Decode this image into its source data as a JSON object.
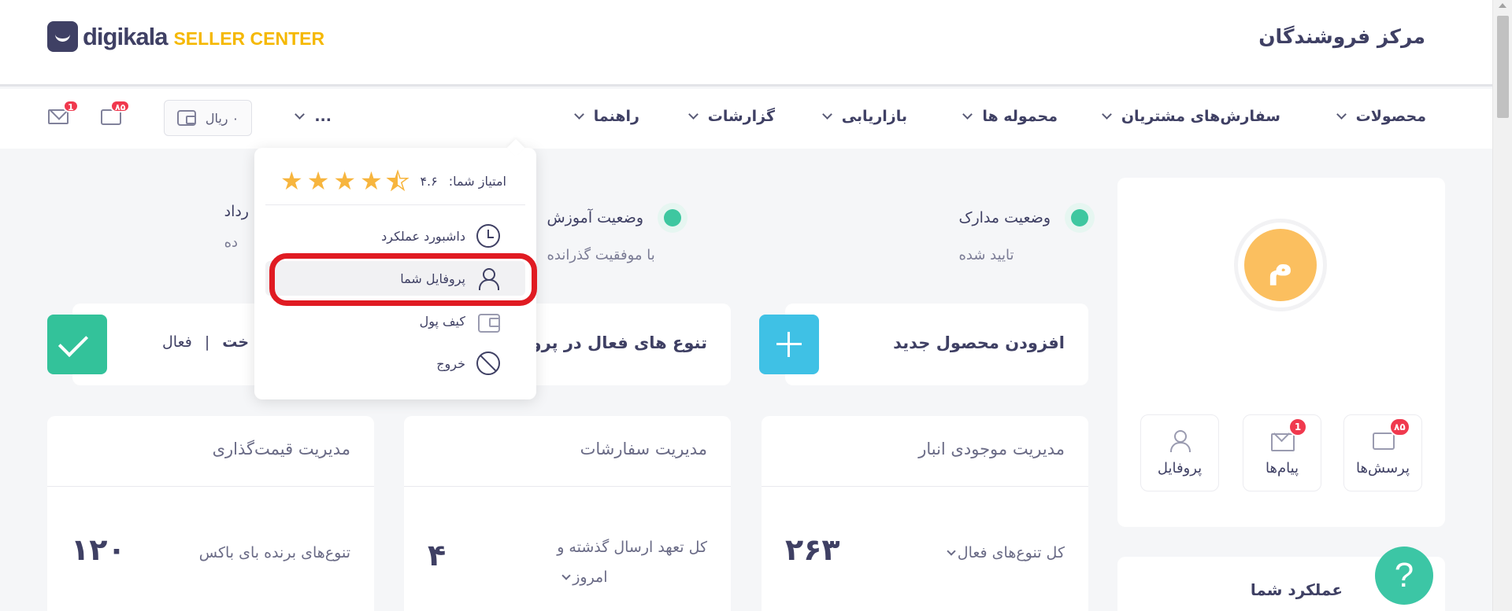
{
  "header": {
    "logo_word": "digikala",
    "logo_sub": "SELLER CENTER",
    "site_title": "مرکز فروشندگان"
  },
  "nav": {
    "items": [
      {
        "label": "محصولات"
      },
      {
        "label": "سفارش‌های مشتریان"
      },
      {
        "label": "محموله ها"
      },
      {
        "label": "بازاریابی"
      },
      {
        "label": "گزارشات"
      },
      {
        "label": "راهنما"
      },
      {
        "label": "..."
      }
    ],
    "wallet_balance": "۰ ریال",
    "questions_badge": "۸۵",
    "messages_badge": "1"
  },
  "user_menu": {
    "rating_label": "امتیاز شما:",
    "rating_value": "۴.۶",
    "rating_numeric": 4.6,
    "items": [
      {
        "label": "داشبورد عملکرد",
        "icon": "clock-icon"
      },
      {
        "label": "پروفایل شما",
        "icon": "user-icon",
        "highlighted": true
      },
      {
        "label": "کیف پول",
        "icon": "wallet-icon"
      },
      {
        "label": "خروج",
        "icon": "logout-icon"
      }
    ]
  },
  "status": [
    {
      "title": "وضعیت مدارک",
      "subtitle": "تایید شده"
    },
    {
      "title": "وضعیت آموزش",
      "subtitle": "با موفقیت گذرانده"
    },
    {
      "title": "رداد",
      "subtitle": "ده"
    }
  ],
  "cards": {
    "add_product": "افزودن محصول جدید",
    "active_variants": "تنوع های فعال در پرو",
    "payment_title": "خت",
    "payment_sep": "|",
    "payment_status": "فعال"
  },
  "management": [
    {
      "title": "مدیریت موجودی انبار",
      "label": "کل تنوع‌های فعال",
      "value": "۲۶۳"
    },
    {
      "title": "مدیریت سفارشات",
      "label_line1": "کل تعهد ارسال گذشته و",
      "label_line2": "امروز",
      "value": "۴"
    },
    {
      "title": "مدیریت قیمت‌گذاری",
      "label": "تنوع‌های برنده بای باکس",
      "value": "۱۲۰"
    }
  ],
  "profile": {
    "avatar_letter": "م",
    "tiles": [
      {
        "label": "پرسش‌ها",
        "badge": "۸۵"
      },
      {
        "label": "پیام‌ها",
        "badge": "1"
      },
      {
        "label": "پروفایل"
      }
    ],
    "performance_title": "عملکرد شما"
  },
  "help": {
    "symbol": "?"
  },
  "colors": {
    "brand_dark": "#3f4064",
    "brand_yellow": "#f5b800",
    "accent_green": "#33c29a",
    "accent_blue": "#3fc1e5",
    "badge_red": "#f0394e",
    "highlight_red": "#e01b22"
  }
}
